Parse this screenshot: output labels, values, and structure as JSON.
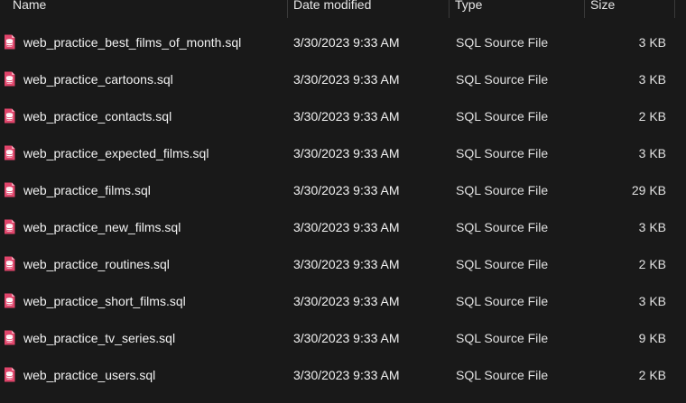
{
  "columns": {
    "name": "Name",
    "date": "Date modified",
    "type": "Type",
    "size": "Size"
  },
  "files": [
    {
      "name": "web_practice_best_films_of_month.sql",
      "date": "3/30/2023 9:33 AM",
      "type": "SQL Source File",
      "size": "3 KB"
    },
    {
      "name": "web_practice_cartoons.sql",
      "date": "3/30/2023 9:33 AM",
      "type": "SQL Source File",
      "size": "3 KB"
    },
    {
      "name": "web_practice_contacts.sql",
      "date": "3/30/2023 9:33 AM",
      "type": "SQL Source File",
      "size": "2 KB"
    },
    {
      "name": "web_practice_expected_films.sql",
      "date": "3/30/2023 9:33 AM",
      "type": "SQL Source File",
      "size": "3 KB"
    },
    {
      "name": "web_practice_films.sql",
      "date": "3/30/2023 9:33 AM",
      "type": "SQL Source File",
      "size": "29 KB"
    },
    {
      "name": "web_practice_new_films.sql",
      "date": "3/30/2023 9:33 AM",
      "type": "SQL Source File",
      "size": "3 KB"
    },
    {
      "name": "web_practice_routines.sql",
      "date": "3/30/2023 9:33 AM",
      "type": "SQL Source File",
      "size": "2 KB"
    },
    {
      "name": "web_practice_short_films.sql",
      "date": "3/30/2023 9:33 AM",
      "type": "SQL Source File",
      "size": "3 KB"
    },
    {
      "name": "web_practice_tv_series.sql",
      "date": "3/30/2023 9:33 AM",
      "type": "SQL Source File",
      "size": "9 KB"
    },
    {
      "name": "web_practice_users.sql",
      "date": "3/30/2023 9:33 AM",
      "type": "SQL Source File",
      "size": "2 KB"
    }
  ],
  "file_icon": "sql-database-file-icon",
  "colors": {
    "background": "#191919",
    "icon_accent": "#e0456b"
  }
}
